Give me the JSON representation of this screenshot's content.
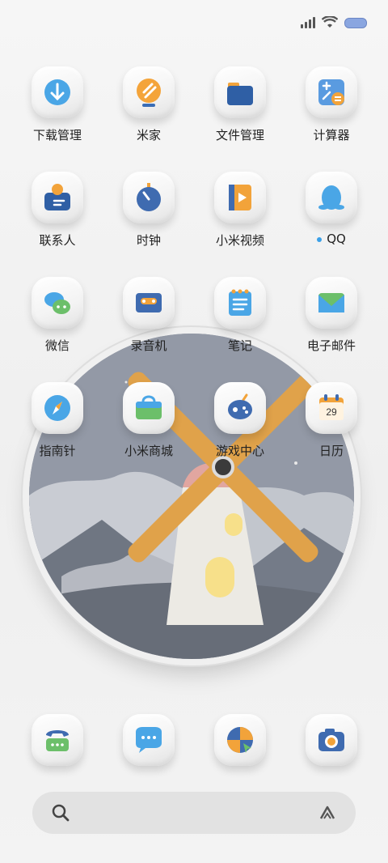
{
  "status_bar": {
    "signal_icon": "signal-icon",
    "wifi_icon": "wifi-icon",
    "battery_icon": "battery-icon"
  },
  "apps": [
    {
      "label": "下载管理",
      "icon": "download-cloud-icon"
    },
    {
      "label": "米家",
      "icon": "mi-home-icon"
    },
    {
      "label": "文件管理",
      "icon": "folder-icon"
    },
    {
      "label": "计算器",
      "icon": "calculator-icon"
    },
    {
      "label": "联系人",
      "icon": "contacts-icon"
    },
    {
      "label": "时钟",
      "icon": "clock-icon"
    },
    {
      "label": "小米视频",
      "icon": "video-icon"
    },
    {
      "label": "QQ",
      "icon": "qq-penguin-icon"
    },
    {
      "label": "微信",
      "icon": "wechat-icon"
    },
    {
      "label": "录音机",
      "icon": "recorder-icon"
    },
    {
      "label": "笔记",
      "icon": "notes-icon"
    },
    {
      "label": "电子邮件",
      "icon": "email-icon"
    },
    {
      "label": "指南针",
      "icon": "compass-icon"
    },
    {
      "label": "小米商城",
      "icon": "mi-store-icon"
    },
    {
      "label": "游戏中心",
      "icon": "game-center-icon"
    },
    {
      "label": "日历",
      "icon": "calendar-icon",
      "date": "29"
    }
  ],
  "dock": [
    {
      "icon": "phone-icon"
    },
    {
      "icon": "messages-icon"
    },
    {
      "icon": "browser-icon"
    },
    {
      "icon": "camera-icon"
    }
  ],
  "widget": {
    "icon": "windmill-globe-icon"
  },
  "search_bar": {
    "left_icon": "search-icon",
    "right_icon": "assistant-icon"
  },
  "colors": {
    "accent_orange": "#f2a33a",
    "accent_blue": "#3f6bb0",
    "bg": "#f1f1f1"
  }
}
